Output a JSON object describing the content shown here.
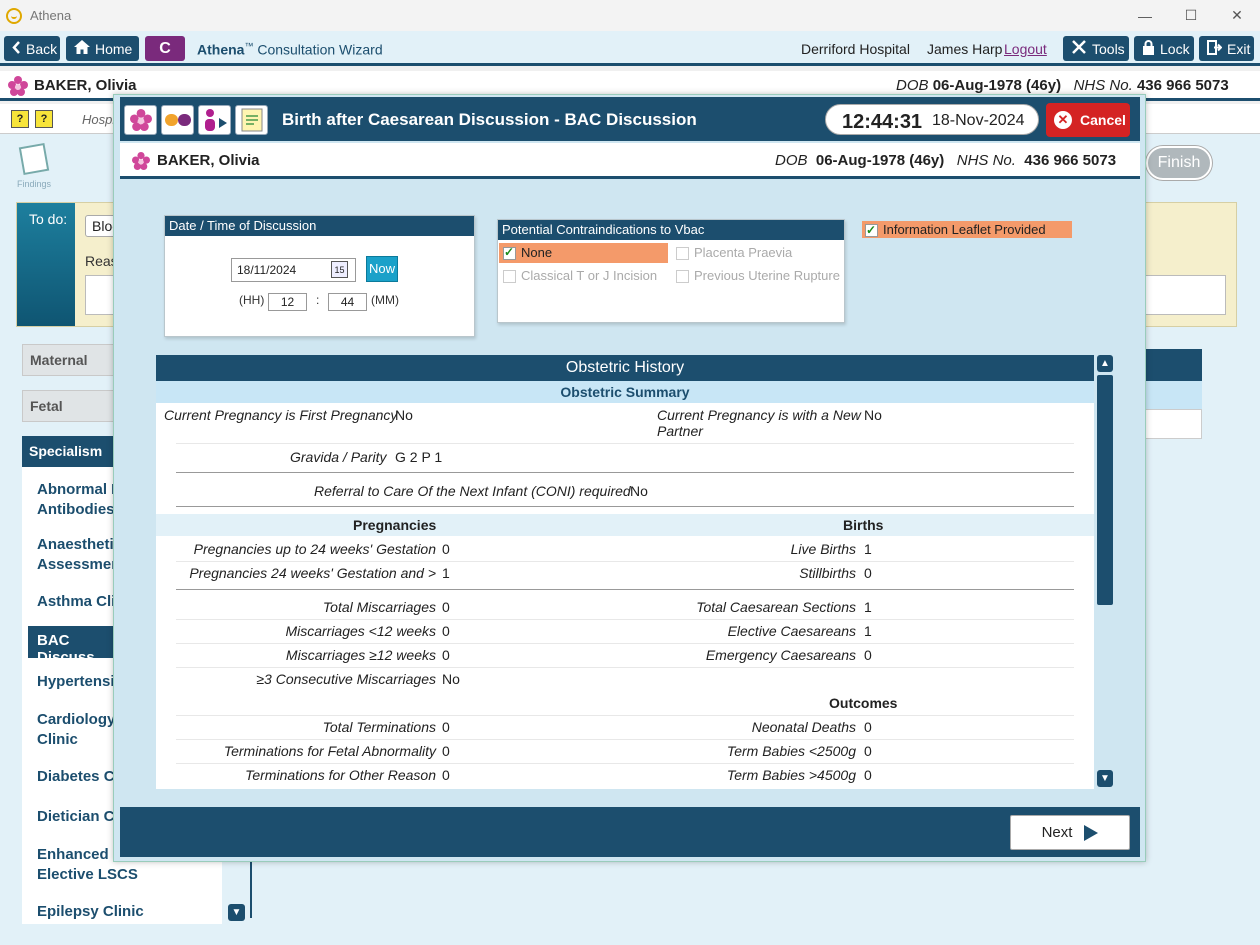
{
  "window": {
    "title": "Athena",
    "minimize_glyph": "—",
    "maximize_glyph": "☐",
    "close_glyph": "✕"
  },
  "appbar": {
    "back_label": "Back",
    "home_label": "Home",
    "c_label": "C",
    "wizard_brand": "Athena",
    "wizard_tm": "™",
    "wizard_title": " Consultation Wizard",
    "hospital": "Derriford Hospital",
    "user": "James Harp",
    "logout_label": "Logout",
    "tools_label": "Tools",
    "lock_label": "Lock",
    "exit_label": "Exit"
  },
  "patient": {
    "name": "BAKER, Olivia",
    "dob_label": "DOB",
    "dob": "06-Aug-1978 (46y)",
    "nhs_label": "NHS No.",
    "nhs": "436 966 5073"
  },
  "background": {
    "q1": "?",
    "q2": "?",
    "hospital_partial": "Hospi",
    "findings_label": "Findings",
    "finish_label": "Finish",
    "todo_label": "To do:",
    "todo_field": "Bloo",
    "reason_partial": "Reas",
    "sidebar": {
      "maternal": "Maternal",
      "fetal": "Fetal",
      "specialism": "Specialism",
      "items": [
        {
          "l1": "Abnormal R",
          "l2": "Antibodies"
        },
        {
          "l1": "Anaesthetic",
          "l2": "Assessment"
        },
        {
          "l1": "Asthma Clin",
          "l2": ""
        },
        {
          "l1": "BAC Discuss",
          "l2": ""
        },
        {
          "l1": "Hypertensio",
          "l2": ""
        },
        {
          "l1": "Cardiology",
          "l2": "Clinic"
        },
        {
          "l1": "Diabetes Cl",
          "l2": ""
        },
        {
          "l1": "Dietician Cl",
          "l2": ""
        },
        {
          "l1": "Enhanced R",
          "l2": "Elective LSCS"
        },
        {
          "l1": "Epilepsy Clinic",
          "l2": ""
        }
      ]
    }
  },
  "modal": {
    "title": "Birth after Caesarean Discussion - BAC Discussion",
    "time": "12:44:31",
    "date": "18-Nov-2024",
    "cancel_label": "Cancel",
    "next_label": "Next",
    "datetime_panel": {
      "title": "Date / Time of Discussion",
      "date_value": "18/11/2024",
      "calendar_day": "15",
      "now_label": "Now",
      "hh_label": "(HH)",
      "hour": "12",
      "colon": ":",
      "minute": "44",
      "mm_label": "(MM)"
    },
    "contra_panel": {
      "title": "Potential Contraindications to Vbac",
      "options": [
        {
          "label": "None",
          "checked": true
        },
        {
          "label": "Placenta Praevia",
          "checked": false
        },
        {
          "label": "Classical T or J Incision",
          "checked": false
        },
        {
          "label": "Previous Uterine Rupture",
          "checked": false
        }
      ]
    },
    "leaflet": {
      "label": "Information Leaflet Provided",
      "checked": true
    },
    "obstetric": {
      "title": "Obstetric History",
      "summary_title": "Obstetric Summary",
      "first_pregnancy_label": "Current Pregnancy is First Pregnancy",
      "first_pregnancy_value": "No",
      "new_partner_label_1": "Current Pregnancy is with a New",
      "new_partner_label_2": "Partner",
      "new_partner_value": "No",
      "gravida_label": "Gravida / Parity",
      "gravida_value": "G 2 P 1",
      "coni_label": "Referral to Care Of the Next Infant (CONI) required",
      "coni_value": "No",
      "pregnancies_title": "Pregnancies",
      "births_title": "Births",
      "outcomes_title": "Outcomes",
      "left_rows": [
        {
          "label": "Pregnancies up to 24 weeks' Gestation",
          "value": "0"
        },
        {
          "label": "Pregnancies 24 weeks' Gestation and >",
          "value": "1"
        },
        {
          "label": "Total Miscarriages",
          "value": "0"
        },
        {
          "label": "Miscarriages <12 weeks",
          "value": "0"
        },
        {
          "label": "Miscarriages ≥12 weeks",
          "value": "0"
        },
        {
          "label": "≥3 Consecutive Miscarriages",
          "value": "No"
        },
        {
          "label": "Total Terminations",
          "value": "0"
        },
        {
          "label": "Terminations for Fetal Abnormality",
          "value": "0"
        },
        {
          "label": "Terminations for Other Reason",
          "value": "0"
        }
      ],
      "right_rows": [
        {
          "label": "Live Births",
          "value": "1"
        },
        {
          "label": "Stillbirths",
          "value": "0"
        },
        {
          "label": "Total Caesarean Sections",
          "value": "1"
        },
        {
          "label": "Elective Caesareans",
          "value": "1"
        },
        {
          "label": "Emergency Caesareans",
          "value": "0"
        },
        {
          "label": "Neonatal Deaths",
          "value": "0"
        },
        {
          "label": "Term Babies <2500g",
          "value": "0"
        },
        {
          "label": "Term Babies >4500g",
          "value": "0"
        }
      ]
    }
  },
  "colors": {
    "primary": "#1c4e6e",
    "accent_purple": "#7a2a7c",
    "highlight_orange": "#f49a6a",
    "cancel_red": "#d42323",
    "now_button": "#1aa1c9"
  }
}
